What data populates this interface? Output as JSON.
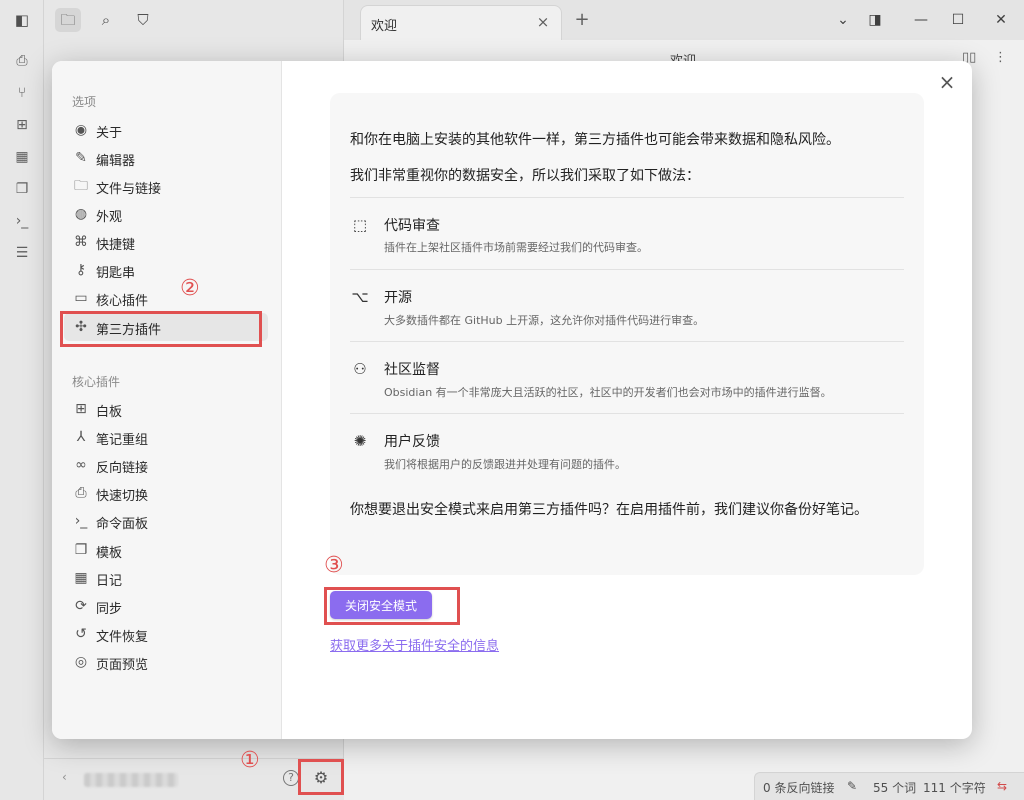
{
  "workspace": {
    "tab_title": "欢迎",
    "tab_close": "×",
    "tab_add": "+",
    "view_title": "欢迎",
    "win_minimize": "—",
    "win_maximize": "☐",
    "win_close": "✕"
  },
  "statusbar": {
    "backlinks": "0 条反向链接",
    "words": "55 个词",
    "chars": "111 个字符"
  },
  "settings": {
    "close_symbol": "×",
    "options_header": "选项",
    "options": [
      {
        "label": "关于",
        "icon": "user-circle-icon"
      },
      {
        "label": "编辑器",
        "icon": "pencil-icon"
      },
      {
        "label": "文件与链接",
        "icon": "folder-link-icon"
      },
      {
        "label": "外观",
        "icon": "palette-icon"
      },
      {
        "label": "快捷键",
        "icon": "command-icon"
      },
      {
        "label": "钥匙串",
        "icon": "key-icon"
      },
      {
        "label": "核心插件",
        "icon": "calendar-plug-icon"
      },
      {
        "label": "第三方插件",
        "icon": "puzzle-icon"
      }
    ],
    "core_header": "核心插件",
    "core_plugins": [
      {
        "label": "白板",
        "icon": "canvas-icon"
      },
      {
        "label": "笔记重组",
        "icon": "merge-icon"
      },
      {
        "label": "反向链接",
        "icon": "backlink-icon"
      },
      {
        "label": "快速切换",
        "icon": "file-search-icon"
      },
      {
        "label": "命令面板",
        "icon": "terminal-icon"
      },
      {
        "label": "模板",
        "icon": "copy-icon"
      },
      {
        "label": "日记",
        "icon": "calendar-icon"
      },
      {
        "label": "同步",
        "icon": "sync-icon"
      },
      {
        "label": "文件恢复",
        "icon": "history-icon"
      },
      {
        "label": "页面预览",
        "icon": "preview-icon"
      }
    ]
  },
  "safety": {
    "intro": "和你在电脑上安装的其他软件一样，第三方插件也可能会带来数据和隐私风险。",
    "lead": "我们非常重视你的数据安全，所以我们采取了如下做法：",
    "features": [
      {
        "icon": "cursor-click-icon",
        "title": "代码审查",
        "desc": "插件在上架社区插件市场前需要经过我们的代码审查。"
      },
      {
        "icon": "github-icon",
        "title": "开源",
        "desc": "大多数插件都在 GitHub 上开源，这允许你对插件代码进行审查。"
      },
      {
        "icon": "users-icon",
        "title": "社区监督",
        "desc": "Obsidian 有一个非常庞大且活跃的社区，社区中的开发者们也会对市场中的插件进行监督。"
      },
      {
        "icon": "bug-icon",
        "title": "用户反馈",
        "desc": "我们将根据用户的反馈跟进并处理有问题的插件。"
      }
    ],
    "question": "你想要退出安全模式来启用第三方插件吗？在启用插件前，我们建议你备份好笔记。",
    "button": "关闭安全模式",
    "link": "获取更多关于插件安全的信息"
  },
  "annotations": {
    "one": "①",
    "two": "②",
    "three": "③",
    "color": "#e05050"
  },
  "colors": {
    "accent": "#8b6cef"
  }
}
